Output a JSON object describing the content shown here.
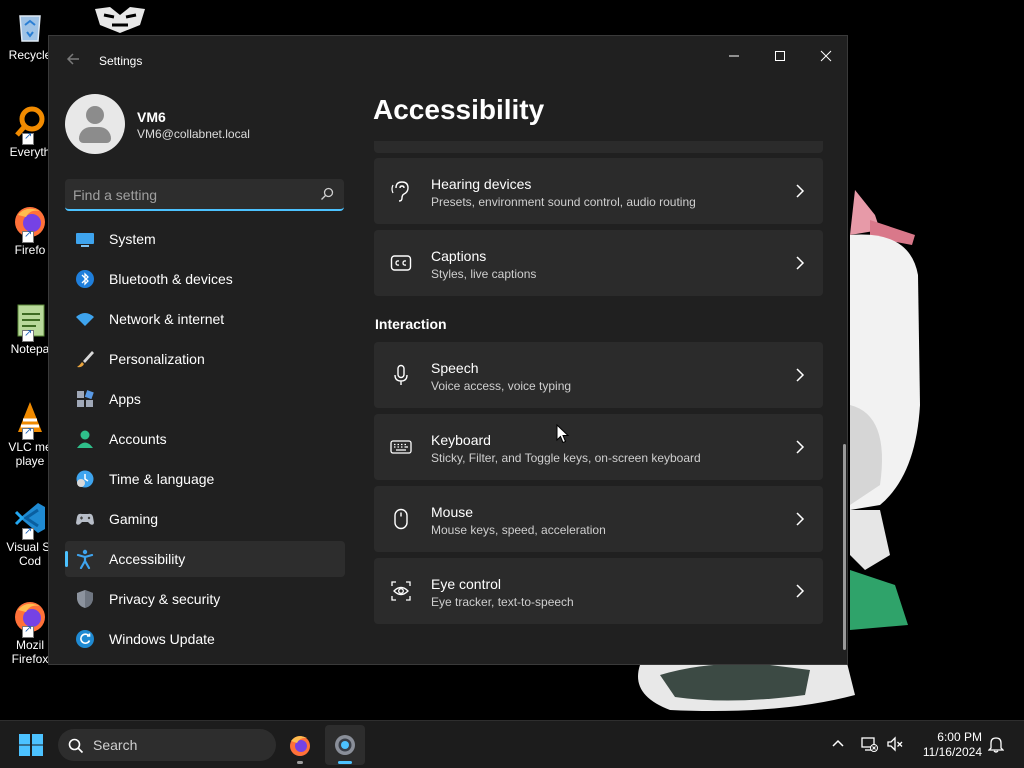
{
  "desktop": {
    "icons": [
      {
        "label": "Recycle",
        "icon": "recycle-bin-icon"
      },
      {
        "label": "Everyth",
        "icon": "everything-search-icon"
      },
      {
        "label": "Firefo",
        "icon": "firefox-icon"
      },
      {
        "label": "Notepa",
        "icon": "notepad-icon"
      },
      {
        "label_line1": "VLC me",
        "label_line2": "playe",
        "icon": "vlc-icon"
      },
      {
        "label_line1": "Visual St",
        "label_line2": "Cod",
        "icon": "vscode-icon"
      },
      {
        "label_line1": "Mozil",
        "label_line2": "Firefox",
        "icon": "firefox-icon"
      }
    ]
  },
  "window": {
    "title": "Settings",
    "controls": {
      "minimize": "—",
      "maximize": "☐",
      "close": "✕"
    },
    "profile": {
      "name": "VM6",
      "email": "VM6@collabnet.local"
    },
    "search": {
      "placeholder": "Find a setting",
      "value": ""
    },
    "nav": [
      {
        "label": "System",
        "icon": "system-display-icon",
        "active": false
      },
      {
        "label": "Bluetooth & devices",
        "icon": "bluetooth-icon",
        "active": false
      },
      {
        "label": "Network & internet",
        "icon": "wifi-icon",
        "active": false
      },
      {
        "label": "Personalization",
        "icon": "paintbrush-icon",
        "active": false
      },
      {
        "label": "Apps",
        "icon": "apps-icon",
        "active": false
      },
      {
        "label": "Accounts",
        "icon": "accounts-icon",
        "active": false
      },
      {
        "label": "Time & language",
        "icon": "time-language-icon",
        "active": false
      },
      {
        "label": "Gaming",
        "icon": "gamepad-icon",
        "active": false
      },
      {
        "label": "Accessibility",
        "icon": "accessibility-icon",
        "active": true
      },
      {
        "label": "Privacy & security",
        "icon": "shield-icon",
        "active": false
      },
      {
        "label": "Windows Update",
        "icon": "windows-update-icon",
        "active": false
      }
    ],
    "main": {
      "title": "Accessibility",
      "cards_top": [
        {
          "title": "Hearing devices",
          "subtitle": "Presets, environment sound control, audio routing",
          "icon": "hearing-icon"
        },
        {
          "title": "Captions",
          "subtitle": "Styles, live captions",
          "icon": "captions-icon"
        }
      ],
      "section_interaction": "Interaction",
      "cards_interaction": [
        {
          "title": "Speech",
          "subtitle": "Voice access, voice typing",
          "icon": "microphone-icon"
        },
        {
          "title": "Keyboard",
          "subtitle": "Sticky, Filter, and Toggle keys, on-screen keyboard",
          "icon": "keyboard-icon"
        },
        {
          "title": "Mouse",
          "subtitle": "Mouse keys, speed, acceleration",
          "icon": "mouse-icon"
        },
        {
          "title": "Eye control",
          "subtitle": "Eye tracker, text-to-speech",
          "icon": "eye-control-icon"
        }
      ]
    }
  },
  "taskbar": {
    "search_label": "Search",
    "apps": [
      {
        "name": "Firefox",
        "icon": "firefox-icon",
        "active": false
      },
      {
        "name": "Settings",
        "icon": "settings-gear-icon",
        "active": true
      }
    ],
    "tray": {
      "chevron": "^",
      "time": "6:00 PM",
      "date": "11/16/2024"
    }
  },
  "colors": {
    "accent": "#4cc2ff",
    "window_bg": "#202020",
    "card_bg": "#2b2b2b",
    "taskbar_bg": "#1c1c1c"
  }
}
